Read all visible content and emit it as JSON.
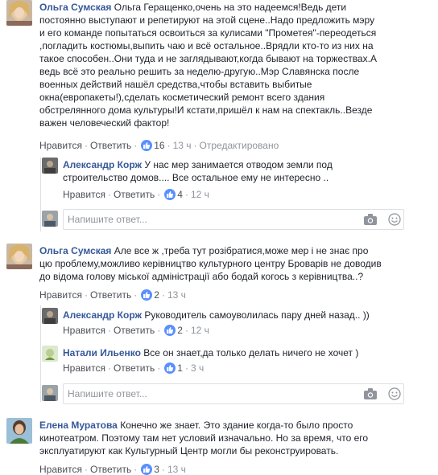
{
  "colors": {
    "link": "#365899",
    "meta": "#90949c",
    "like": "#5890ff",
    "text": "#1d2129"
  },
  "comments": [
    {
      "author": "Ольга Сумская",
      "text_lines": [
        "Ольга Геращенко,очень на это надеемся!Ведь дети",
        "постоянно выступают и репетируют на этой сцене..Надо предложить мэру",
        "и его команде попытаться освоиться за кулисами \"Прометея\"-переодеться",
        ",погладить костюмы,выпить чаю и всё остальное..Врядли кто-то из них на",
        "такое способен..Они туда и не заглядывают,когда бывают на торжествах.А",
        "ведь всё это реально решить за неделю-другую..Мэр Славянска после",
        "военных действий нашёл средства,чтобы вставить выбитые",
        "окна(европакеты!),сделать косметический ремонт всего здания",
        "обстрелянного дома культуры!И кстати,пришёл к нам на спектакль..Везде",
        "важен человеческий фактор!"
      ],
      "like_label": "Нравится",
      "reply_label": "Ответить",
      "likes": "16",
      "time": "13 ч",
      "edited": "Отредактировано"
    },
    {
      "author": "Александр Корж",
      "text_lines": [
        "У нас мер занимается отводом земли под",
        "строительство домов.... Все остальное ему не интересно .."
      ],
      "like_label": "Нравится",
      "reply_label": "Ответить",
      "likes": "4",
      "time": "12 ч"
    },
    {
      "author": "Ольга Сумская",
      "text_lines": [
        "Але все ж ,треба тут розібратися,може мер і не знає про",
        "цю проблему,можливо керівництво культурного центру Броварів не доводив",
        "до відома голову міської адміністрації або бодай когось з керівництва..?"
      ],
      "like_label": "Нравится",
      "reply_label": "Ответить",
      "likes": "2",
      "time": "13 ч"
    },
    {
      "author": "Александр Корж",
      "text_lines": [
        "Руководитель самоуволилась пару дней назад.. ))"
      ],
      "like_label": "Нравится",
      "reply_label": "Ответить",
      "likes": "2",
      "time": "12 ч"
    },
    {
      "author": "Натали Ильенко",
      "text_lines": [
        "Все он знает,да только делать ничего не хочет )"
      ],
      "like_label": "Нравится",
      "reply_label": "Ответить",
      "likes": "1",
      "time": "3 ч"
    },
    {
      "author": "Елена Муратова",
      "text_lines": [
        "Конечно же знает. Это здание когда-то было просто",
        "кинотеатром. Поэтому там нет условий изначально. Но за время, что его",
        "эксплуатируют как Культурный Центр могли бы реконструировать."
      ],
      "like_label": "Нравится",
      "reply_label": "Ответить",
      "likes": "3",
      "time": "13 ч"
    }
  ],
  "reply_boxes": [
    {
      "placeholder": "Напишите ответ..."
    },
    {
      "placeholder": "Напишите ответ..."
    }
  ]
}
